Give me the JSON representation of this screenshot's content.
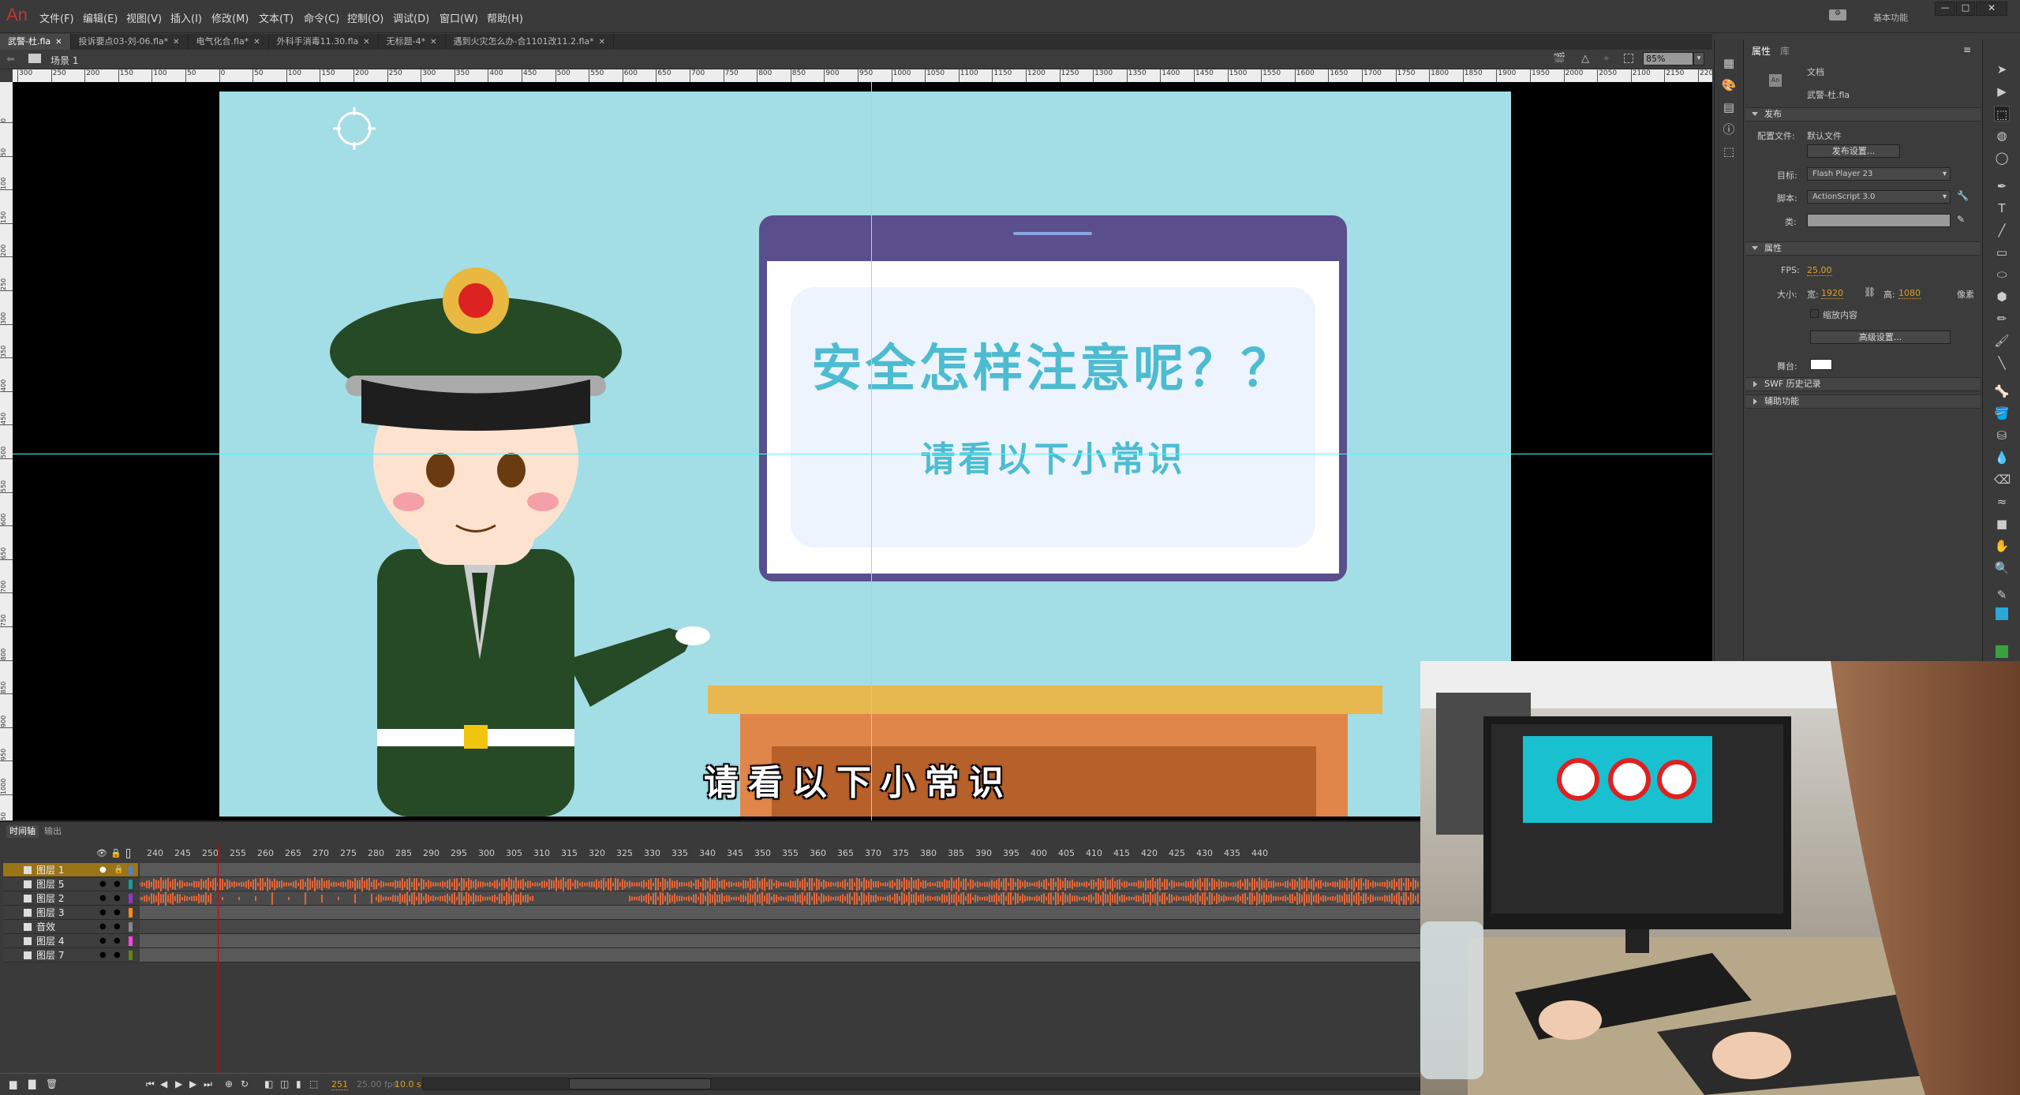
{
  "app": {
    "logo": "An",
    "menu": [
      "文件(F)",
      "编辑(E)",
      "视图(V)",
      "插入(I)",
      "修改(M)",
      "文本(T)",
      "命令(C)",
      "控制(O)",
      "调试(D)",
      "窗口(W)",
      "帮助(H)"
    ],
    "workspace": "基本功能"
  },
  "tabs": [
    {
      "label": "武警-杜.fla",
      "active": true
    },
    {
      "label": "投诉要点03-刘-06.fla*"
    },
    {
      "label": "电气化合.fla*"
    },
    {
      "label": "外科手消毒11.30.fla"
    },
    {
      "label": "无标题-4*"
    },
    {
      "label": "遇到火灾怎么办-合1101改11.2.fla*"
    }
  ],
  "scene": {
    "label": "场景 1",
    "zoom": "85%"
  },
  "rulers": {
    "h": [
      "300",
      "250",
      "200",
      "150",
      "100",
      "50",
      "0",
      "50",
      "100",
      "150",
      "200",
      "250",
      "300",
      "350",
      "400",
      "450",
      "500",
      "550",
      "600",
      "650",
      "700",
      "750",
      "800",
      "850",
      "900",
      "950",
      "1000",
      "1050",
      "1100",
      "1150",
      "1200",
      "1250",
      "1300",
      "1350",
      "1400",
      "1450",
      "1500",
      "1550",
      "1600",
      "1650",
      "1700",
      "1750",
      "1800",
      "1850",
      "1900",
      "1950",
      "2000",
      "2050",
      "2100",
      "2150",
      "2200"
    ],
    "v": [
      "0",
      "50",
      "100",
      "150",
      "200",
      "250",
      "300",
      "350",
      "400",
      "450",
      "500",
      "550",
      "600",
      "650",
      "700",
      "750",
      "800",
      "850",
      "900",
      "950",
      "1000",
      "1050"
    ]
  },
  "stage": {
    "card_title": "安全怎样注意呢？？",
    "card_subtitle": "请看以下小常识",
    "subtitle": "请看以下小常识",
    "bg": "#a3dde6",
    "accent": "#4dbcd0"
  },
  "properties": {
    "tabs": [
      "属性",
      "库"
    ],
    "doc_type": "文档",
    "doc_name": "武警-杜.fla",
    "publish": {
      "header": "发布",
      "profile_label": "配置文件:",
      "profile_value": "默认文件",
      "publish_settings": "发布设置...",
      "target_label": "目标:",
      "target": "Flash Player 23",
      "script_label": "脚本:",
      "script": "ActionScript 3.0",
      "class_label": "类:"
    },
    "props": {
      "header": "属性",
      "fps_label": "FPS:",
      "fps": "25.00",
      "size_label": "大小:",
      "width_label": "宽:",
      "width": "1920",
      "height_label": "高:",
      "height": "1080",
      "unit": "像素",
      "scale_content": "缩放内容",
      "advanced": "高级设置...",
      "stage_label": "舞台:"
    },
    "swf_history": "SWF 历史记录",
    "accessibility": "辅助功能"
  },
  "timeline": {
    "tabs": [
      "时间轴",
      "输出"
    ],
    "frame_labels": [
      "240",
      "245",
      "250",
      "255",
      "260",
      "265",
      "270",
      "275",
      "280",
      "285",
      "290",
      "295",
      "300",
      "305",
      "310",
      "315",
      "320",
      "325",
      "330",
      "335",
      "340",
      "345",
      "350",
      "355",
      "360",
      "365",
      "370",
      "375",
      "380",
      "385",
      "390",
      "395",
      "400",
      "405",
      "410",
      "415",
      "420",
      "425",
      "430",
      "435",
      "440"
    ],
    "layers": [
      {
        "name": "图层 1",
        "color": "#4a7fe0",
        "selected": true
      },
      {
        "name": "图层 5",
        "color": "#1a9a9a"
      },
      {
        "name": "图层 2",
        "color": "#9933cc"
      },
      {
        "name": "图层 3",
        "color": "#ff8c1a"
      },
      {
        "name": "音效",
        "color": "#888888"
      },
      {
        "name": "图层 4",
        "color": "#ff44ee"
      },
      {
        "name": "图层 7",
        "color": "#5a8a10"
      }
    ],
    "current_frame": "251",
    "fps": "25.00 fps",
    "time": "10.0 s"
  }
}
